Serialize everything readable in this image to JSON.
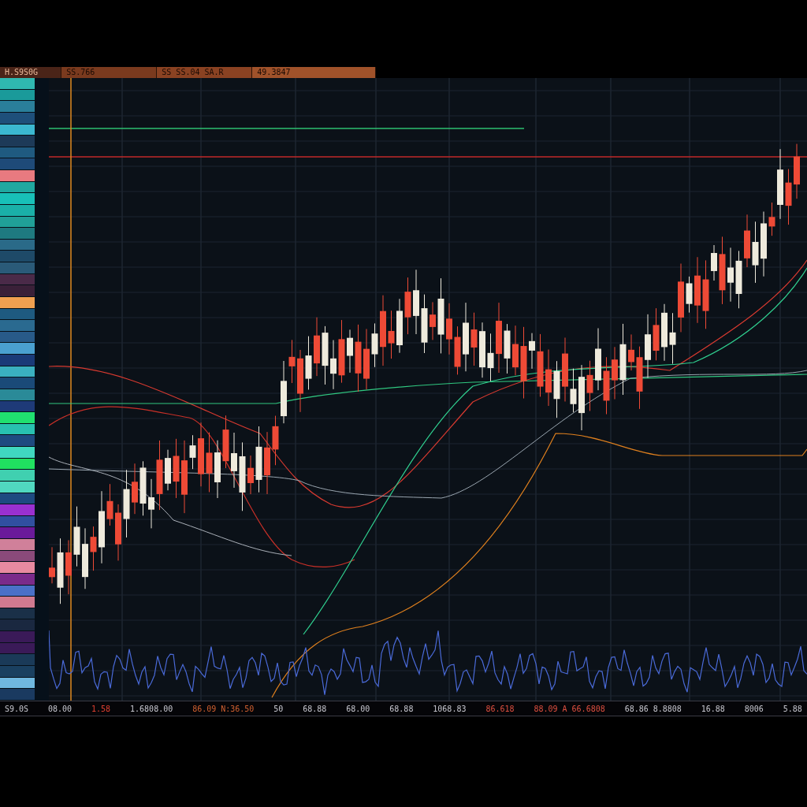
{
  "header": {
    "cells": [
      {
        "label": "H.S9S0G",
        "color": "#4a2418"
      },
      {
        "label": "SS.766",
        "color": "#7a3a1e"
      },
      {
        "label": "SS SS.04  SA.R",
        "color": "#8a4222"
      },
      {
        "label": "49.3847",
        "color": "#a0522a"
      }
    ]
  },
  "sidebar": {
    "rows": [
      {
        "color": "#2fb8b0"
      },
      {
        "color": "#1a9a9a"
      },
      {
        "color": "#2a7f9a"
      },
      {
        "color": "#1e4f7a"
      },
      {
        "color": "#3bb8d0"
      },
      {
        "color": "#1d3a58"
      },
      {
        "color": "#1f5a80"
      },
      {
        "color": "#1e4a78"
      },
      {
        "color": "#e87a80"
      },
      {
        "color": "#20a8a0"
      },
      {
        "color": "#18c0b8"
      },
      {
        "color": "#1ab0a8"
      },
      {
        "color": "#20a098"
      },
      {
        "color": "#1e7a80"
      },
      {
        "color": "#2a6a88"
      },
      {
        "color": "#1e4a68"
      },
      {
        "color": "#2a5a78"
      },
      {
        "color": "#4a2a48"
      },
      {
        "color": "#3a2038"
      },
      {
        "color": "#f0a050"
      },
      {
        "color": "#1e5a80"
      },
      {
        "color": "#2a6a90"
      },
      {
        "color": "#285a88"
      },
      {
        "color": "#4aa0d0"
      },
      {
        "color": "#1a3a78"
      },
      {
        "color": "#3ab0c0"
      },
      {
        "color": "#1a4a78"
      },
      {
        "color": "#2a8a98"
      },
      {
        "color": "#1e3a78"
      },
      {
        "color": "#20e070"
      },
      {
        "color": "#28c0b0"
      },
      {
        "color": "#1e4a80"
      },
      {
        "color": "#40d8c0"
      },
      {
        "color": "#20e060"
      },
      {
        "color": "#40d0b0"
      },
      {
        "color": "#50d8c0"
      },
      {
        "color": "#1e4a80"
      },
      {
        "color": "#9a30d0"
      },
      {
        "color": "#3050a0"
      },
      {
        "color": "#6a1a9a"
      },
      {
        "color": "#d0809a"
      },
      {
        "color": "#8a4a7a"
      },
      {
        "color": "#e88aa0"
      },
      {
        "color": "#7a2a8a"
      },
      {
        "color": "#4a70c8"
      },
      {
        "color": "#d07a90"
      },
      {
        "color": "#1a3048"
      },
      {
        "color": "#1a2840"
      },
      {
        "color": "#3a1a58"
      },
      {
        "color": "#3a1a58"
      },
      {
        "color": "#1a3a58"
      },
      {
        "color": "#1a4060"
      },
      {
        "color": "#70b8e0"
      },
      {
        "color": "#1a3a60"
      }
    ]
  },
  "footer": {
    "items": [
      {
        "label": "S9.0S",
        "color": "#c8c8d0"
      },
      {
        "label": "08.00",
        "color": "#c8c8d0"
      },
      {
        "label": "1.58",
        "color": "#e04030"
      },
      {
        "label": "1.6808.00",
        "color": "#c8c8d0"
      },
      {
        "label": "86.09 N:36.50",
        "color": "#d06030"
      },
      {
        "label": "50",
        "color": "#c8c8d0"
      },
      {
        "label": "68.88",
        "color": "#c8c8d0"
      },
      {
        "label": "68.00",
        "color": "#c8c8d0"
      },
      {
        "label": "68.88",
        "color": "#c8c8d0"
      },
      {
        "label": "1068.83",
        "color": "#c8c8d0"
      },
      {
        "label": "86.618",
        "color": "#e05040"
      },
      {
        "label": "88.09 A 66.6808",
        "color": "#e05040"
      },
      {
        "label": "68.86 8.8808",
        "color": "#c8c8d0"
      },
      {
        "label": "16.88",
        "color": "#c8c8d0"
      },
      {
        "label": "8006",
        "color": "#c8c8d0"
      },
      {
        "label": "5.88",
        "color": "#c8c8d0"
      }
    ]
  }
}
